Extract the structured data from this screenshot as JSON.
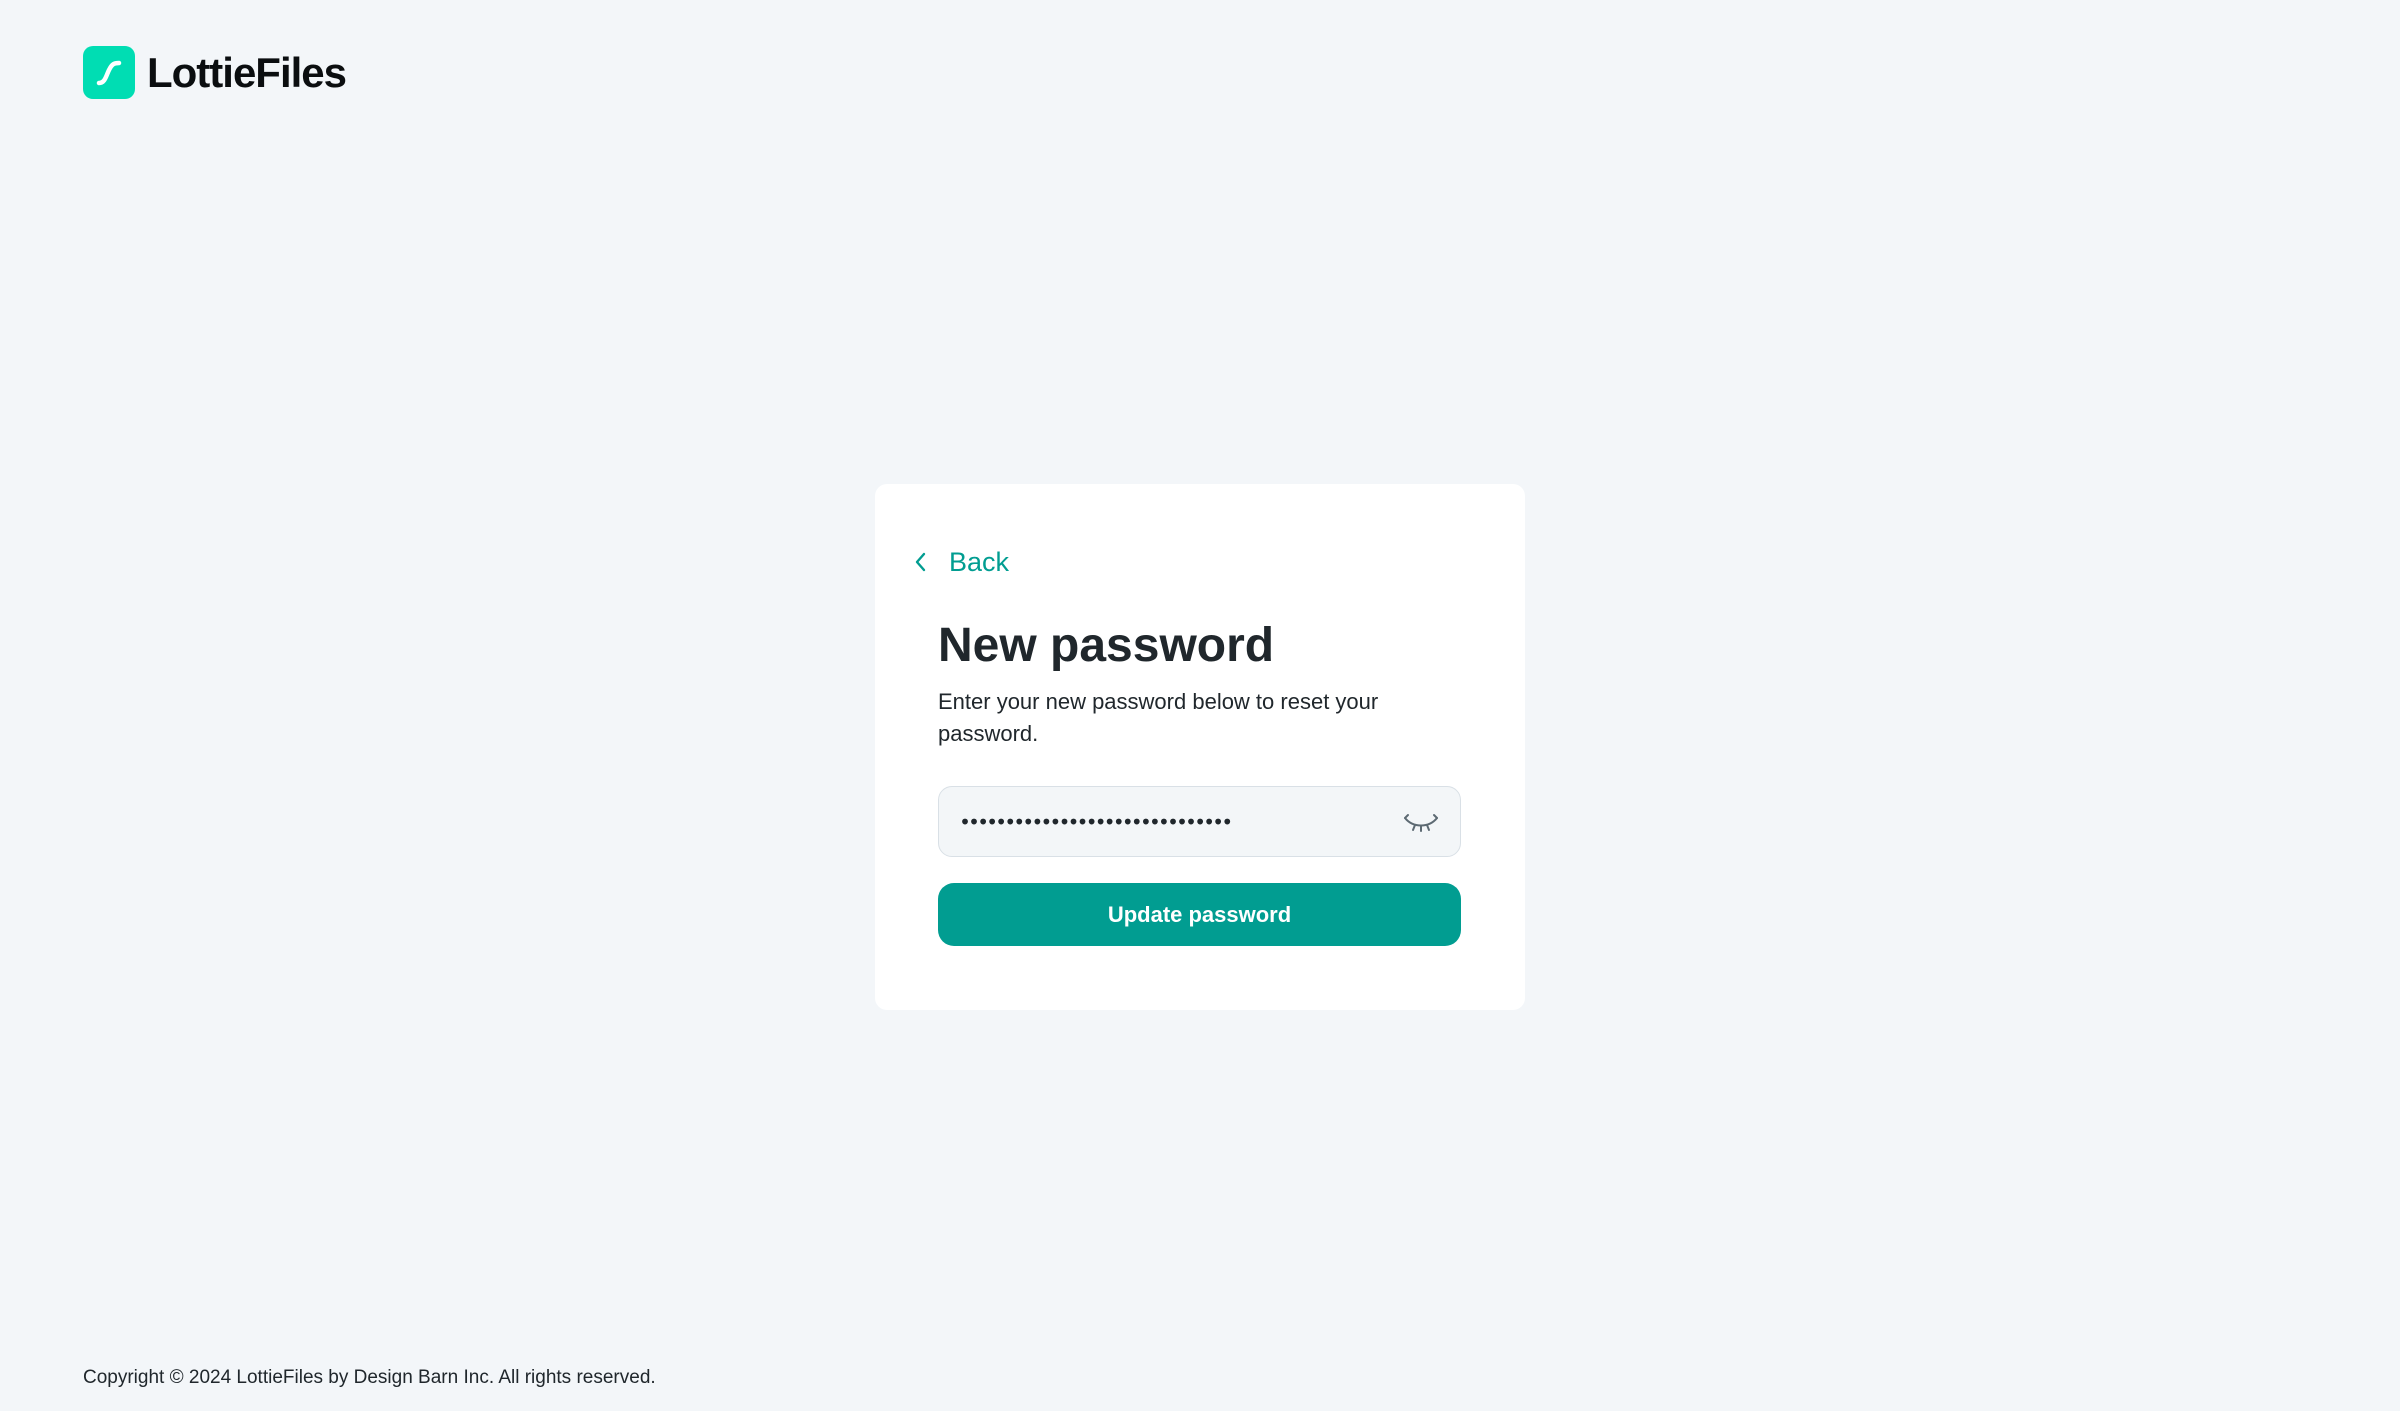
{
  "brand": {
    "name": "LottieFiles",
    "accent_color": "#00ddb3",
    "logo_icon": "lottiefiles-logo-icon"
  },
  "card": {
    "back_label": "Back",
    "back_icon": "chevron-left-icon",
    "title": "New password",
    "subtitle": "Enter your new password below to reset your password.",
    "password": {
      "value": "••••••••••••••••••••••••••••••",
      "toggle_icon": "eye-closed-icon"
    },
    "submit_label": "Update password",
    "primary_color": "#019d91"
  },
  "footer": {
    "copyright": "Copyright © 2024 LottieFiles by Design Barn Inc. All rights reserved."
  }
}
